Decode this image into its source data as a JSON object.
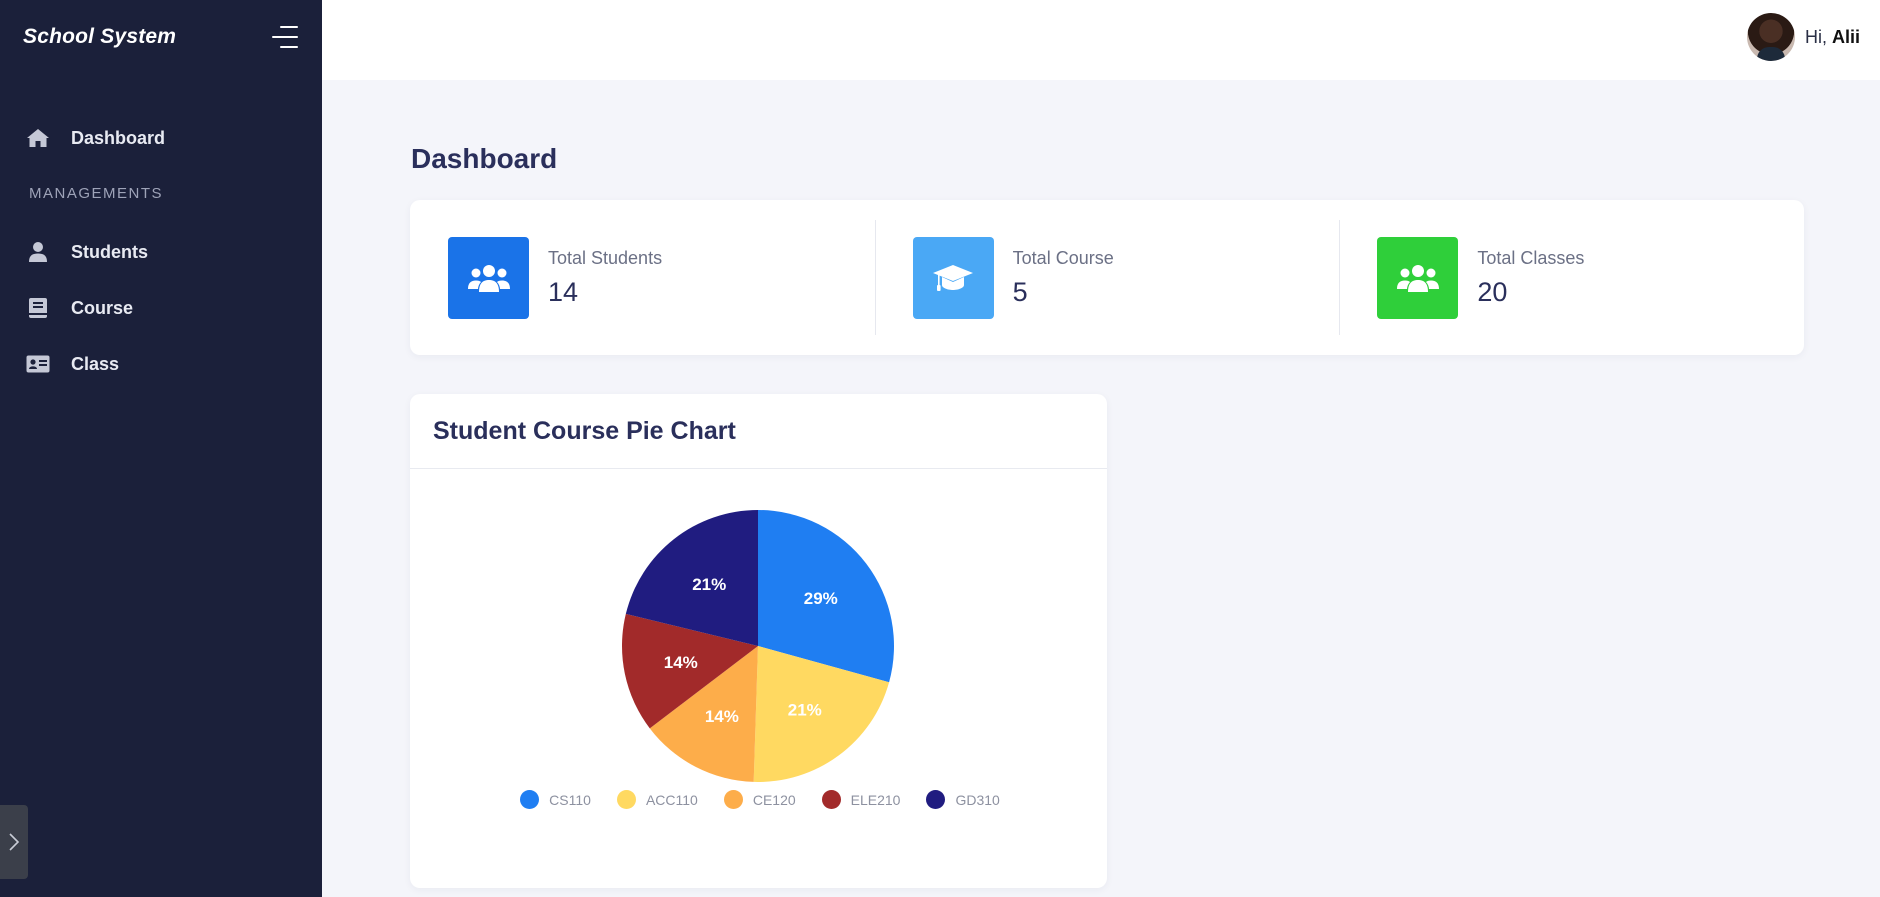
{
  "app": {
    "brand": "School System"
  },
  "sidebar": {
    "items_top": [
      {
        "label": "Dashboard",
        "icon": "home-icon"
      }
    ],
    "section_label": "MANAGEMENTS",
    "items": [
      {
        "label": "Students",
        "icon": "user-icon"
      },
      {
        "label": "Course",
        "icon": "book-icon"
      },
      {
        "label": "Class",
        "icon": "id-card-icon"
      }
    ]
  },
  "header": {
    "greeting": "Hi,",
    "username": "Alii"
  },
  "main": {
    "title": "Dashboard",
    "stats": [
      {
        "label": "Total Students",
        "value": "14",
        "color": "#1a73e8",
        "icon": "users-icon"
      },
      {
        "label": "Total Course",
        "value": "5",
        "color": "#4aa8f5",
        "icon": "graduation-cap-icon"
      },
      {
        "label": "Total Classes",
        "value": "20",
        "color": "#2fcf3a",
        "icon": "users-icon"
      }
    ],
    "chart_card_title": "Student Course Pie Chart"
  },
  "chart_data": {
    "type": "pie",
    "categories": [
      "CS110",
      "ACC110",
      "CE120",
      "ELE210",
      "GD310"
    ],
    "values": [
      29,
      21,
      14,
      14,
      21
    ],
    "labels": [
      "29%",
      "21%",
      "14%",
      "14%",
      "21%"
    ],
    "colors": [
      "#1f7ef2",
      "#ffd961",
      "#fdad4a",
      "#a22a2a",
      "#201c80"
    ],
    "legend_position": "bottom"
  }
}
